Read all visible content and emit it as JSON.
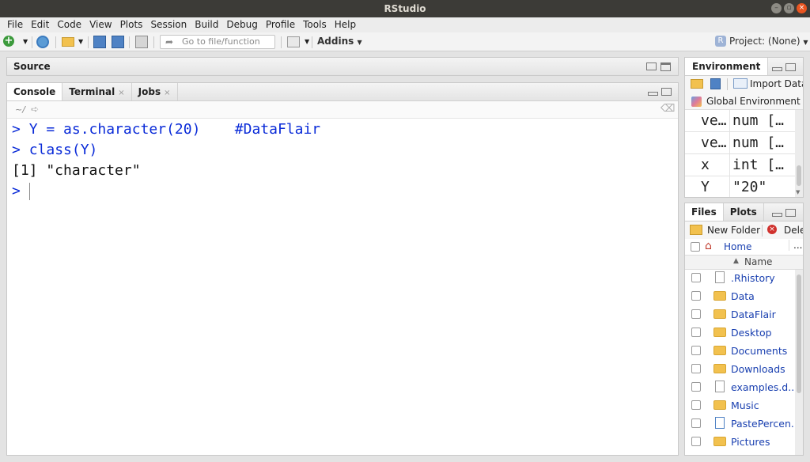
{
  "window": {
    "title": "RStudio"
  },
  "menu": [
    "File",
    "Edit",
    "Code",
    "View",
    "Plots",
    "Session",
    "Build",
    "Debug",
    "Profile",
    "Tools",
    "Help"
  ],
  "toolbar": {
    "goto_placeholder": "Go to file/function",
    "addins_label": "Addins",
    "project_label": "Project: (None)"
  },
  "source_pane": {
    "title": "Source"
  },
  "console_pane": {
    "tabs": [
      "Console",
      "Terminal",
      "Jobs"
    ],
    "path": "~/",
    "lines": [
      {
        "prompt": ">",
        "text": "Y = as.character(20)    #DataFlair"
      },
      {
        "prompt": ">",
        "text": "class(Y)"
      },
      {
        "prompt": "",
        "text": "[1] \"character\""
      },
      {
        "prompt": ">",
        "text": ""
      }
    ]
  },
  "env_pane": {
    "tab": "Environment",
    "import_label": "Import Datas",
    "scope_label": "Global Environment",
    "rows": [
      {
        "name": "ve…",
        "value": "num […"
      },
      {
        "name": "ve…",
        "value": "num […"
      },
      {
        "name": "x",
        "value": "int […"
      },
      {
        "name": "Y",
        "value": "\"20\""
      }
    ]
  },
  "files_pane": {
    "tabs": [
      "Files",
      "Plots"
    ],
    "new_folder_label": "New Folder",
    "delete_label": "Dele",
    "breadcrumb": "Home",
    "more_label": "...",
    "column_header": "Name",
    "files": [
      {
        "name": ".Rhistory",
        "icon": "history-file-icon"
      },
      {
        "name": "Data",
        "icon": "folder-icon"
      },
      {
        "name": "DataFlair",
        "icon": "folder-icon"
      },
      {
        "name": "Desktop",
        "icon": "folder-icon"
      },
      {
        "name": "Documents",
        "icon": "folder-icon"
      },
      {
        "name": "Downloads",
        "icon": "folder-icon"
      },
      {
        "name": "examples.d...",
        "icon": "document-icon"
      },
      {
        "name": "Music",
        "icon": "folder-icon"
      },
      {
        "name": "PastePercen...",
        "icon": "r-file-icon"
      },
      {
        "name": "Pictures",
        "icon": "folder-icon"
      }
    ]
  },
  "colors": {
    "console_text": "#0a2bd8",
    "title_bar": "#3c3b37",
    "close_button": "#e95420"
  }
}
